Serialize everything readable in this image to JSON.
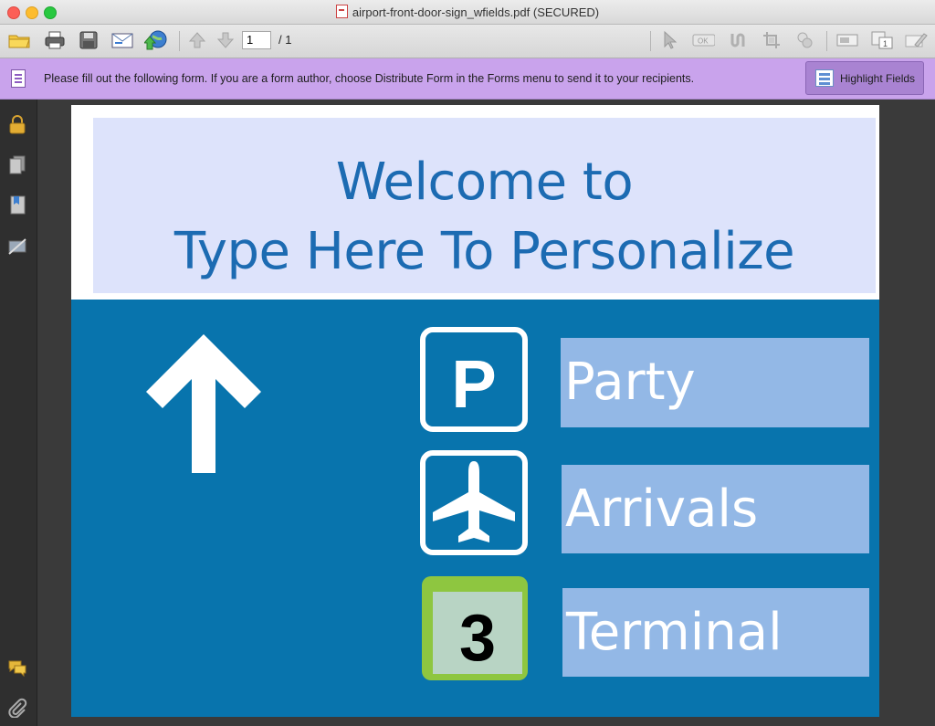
{
  "window": {
    "title": "airport-front-door-sign_wfields.pdf (SECURED)"
  },
  "toolbar": {
    "page_current": "1",
    "page_total": "/ 1"
  },
  "banner": {
    "message": "Please fill out the following form. If you are a form author, choose Distribute Form in the Forms menu to send it to your recipients.",
    "highlight_label": "Highlight Fields"
  },
  "document": {
    "welcome_line1": "Welcome to",
    "welcome_line2": "Type Here To Personalize",
    "parking_letter": "P",
    "terminal_number": "3",
    "field_parking": "Party",
    "field_arrivals": "Arrivals",
    "field_terminal": "Terminal"
  },
  "colors": {
    "banner": "#c9a3ec",
    "sign_blue": "#0874ad",
    "welcome_band": "#dde3fb",
    "welcome_text": "#1c6bb2",
    "field_fill": "#93b8e6",
    "terminal_green": "#8ec640"
  }
}
